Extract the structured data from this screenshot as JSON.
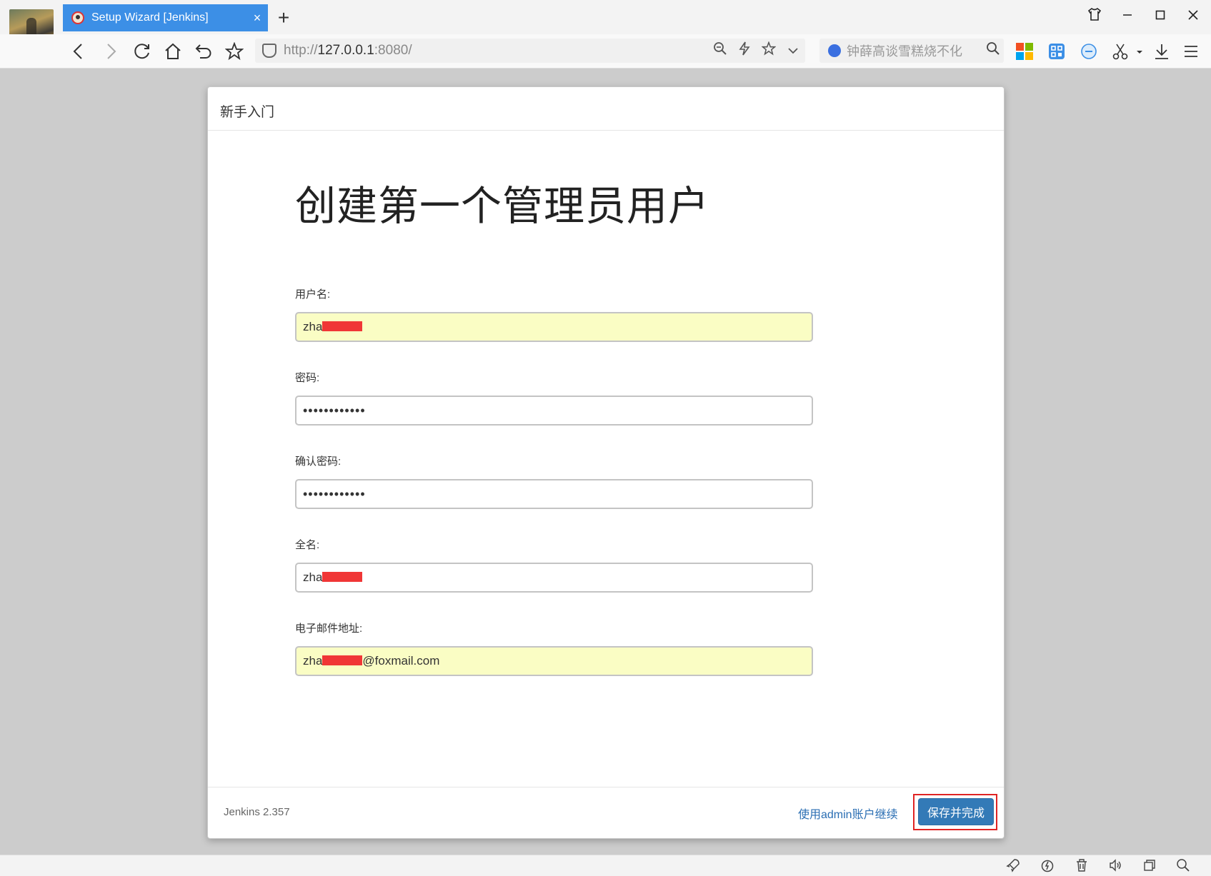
{
  "browser": {
    "tab_title": "Setup Wizard [Jenkins]",
    "tab_close": "×",
    "new_tab": "+",
    "url_prefix": "http://",
    "url_host": "127.0.0.1",
    "url_suffix": ":8080/",
    "search_placeholder": "钟薛高谈雪糕烧不化",
    "window_controls": [
      "⌂",
      "—",
      "☐",
      "✕"
    ],
    "accent": "#3c8fe6"
  },
  "wizard": {
    "header": "新手入门",
    "title": "创建第一个管理员用户",
    "fields": [
      {
        "label": "用户名:",
        "value": "zha"
      },
      {
        "label": "密码:",
        "value": "••••••••••••"
      },
      {
        "label": "确认密码:",
        "value": "••••••••••••"
      },
      {
        "label": "全名:",
        "value": "zha"
      },
      {
        "label": "电子邮件地址:",
        "value_prefix": "zha",
        "value_suffix": "@foxmail.com"
      }
    ],
    "version": "Jenkins 2.357",
    "admin_link": "使用admin账户继续",
    "save_button": "保存并完成",
    "button_color": "#337ab7",
    "highlight_color": "#e02424"
  }
}
